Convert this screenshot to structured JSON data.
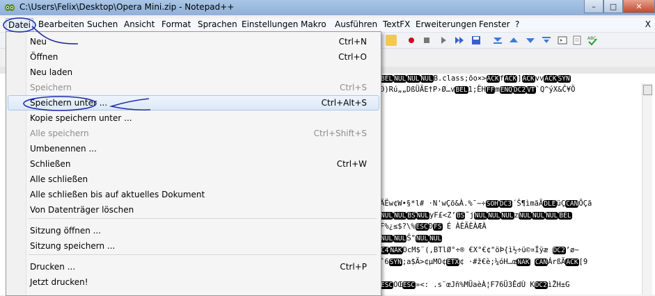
{
  "window": {
    "title": "C:\\Users\\Felix\\Desktop\\Opera Mini.zip - Notepad++",
    "minimize": "–",
    "maximize": "□",
    "close": "✕"
  },
  "menubar": {
    "items": [
      "Datei",
      "Bearbeiten",
      "Suchen",
      "Ansicht",
      "Format",
      "Sprachen",
      "Einstellungen",
      "Makro",
      "Ausführen",
      "TextFX",
      "Erweiterungen",
      "Fenster",
      "?"
    ],
    "close": "X"
  },
  "menu": {
    "items": [
      {
        "label": "Neu",
        "shortcut": "Ctrl+N",
        "enabled": true
      },
      {
        "label": "Öffnen",
        "shortcut": "Ctrl+O",
        "enabled": true
      },
      {
        "label": "Neu laden",
        "shortcut": "",
        "enabled": true
      },
      {
        "label": "Speichern",
        "shortcut": "Ctrl+S",
        "enabled": false
      },
      {
        "label": "Speichern unter ...",
        "shortcut": "Ctrl+Alt+S",
        "enabled": true,
        "highlighted": true
      },
      {
        "label": "Kopie speichern unter ...",
        "shortcut": "",
        "enabled": true
      },
      {
        "label": "Alle speichern",
        "shortcut": "Ctrl+Shift+S",
        "enabled": false
      },
      {
        "label": "Umbenennen ...",
        "shortcut": "",
        "enabled": true
      },
      {
        "label": "Schließen",
        "shortcut": "Ctrl+W",
        "enabled": true
      },
      {
        "label": "Alle schließen",
        "shortcut": "",
        "enabled": true
      },
      {
        "label": "Alle schließen bis auf aktuelles Dokument",
        "shortcut": "",
        "enabled": true
      },
      {
        "label": "Von Datenträger löschen",
        "shortcut": "",
        "enabled": true
      },
      {
        "label": "Sitzung öffnen ...",
        "shortcut": "",
        "enabled": true
      },
      {
        "label": "Sitzung speichern ...",
        "shortcut": "",
        "enabled": true
      },
      {
        "label": "Drucken ...",
        "shortcut": "Ctrl+P",
        "enabled": true
      },
      {
        "label": "Jetzt drucken!",
        "shortcut": "",
        "enabled": true
      }
    ]
  },
  "editor": {
    "lines": [
      {
        "parts": [
          {
            "c": "BEL"
          },
          {
            "c": "NUL"
          },
          {
            "c": "NUL"
          },
          {
            "c": "NUL"
          },
          {
            "t": "B.class;õo×>"
          },
          {
            "c": "ACK"
          },
          {
            "t": "f"
          },
          {
            "c": "ACK"
          },
          {
            "t": "]"
          },
          {
            "c": "ACK"
          },
          {
            "t": "vv"
          },
          {
            "c": "ACK"
          },
          {
            "c": "SYN"
          }
        ]
      },
      {
        "parts": [
          {
            "t": "Ð)Rú„„DßÜÄE†P›Ø…v"
          },
          {
            "c": "BEL"
          },
          {
            "t": "1;ËH"
          },
          {
            "c": "FF"
          },
          {
            "t": "m"
          },
          {
            "c": "ENQ"
          },
          {
            "c": "DC2"
          },
          {
            "c": "VT"
          },
          {
            "t": "`Q^ýX&Ĉ¥Ö"
          }
        ]
      },
      {
        "parts": [
          {
            "t": "ÄËw¢W•§*l# ·N'wÇõ&À.%¯~÷"
          },
          {
            "c": "SOH"
          },
          {
            "c": "DC3"
          },
          {
            "t": "´Š¶ìmãÄ"
          },
          {
            "c": "DLE"
          },
          {
            "t": "üÇ"
          },
          {
            "c": "CAN"
          },
          {
            "t": "ÖÇã"
          }
        ]
      },
      {
        "parts": [
          {
            "c": "NUL"
          },
          {
            "c": "NUL"
          },
          {
            "c": "BS"
          },
          {
            "c": "NUL"
          },
          {
            "t": "yF£<Z’"
          },
          {
            "c": "BS"
          },
          {
            "t": "˜j"
          },
          {
            "c": "NUL"
          },
          {
            "c": "NUL"
          },
          {
            "c": "NUL"
          },
          {
            "t": "z"
          },
          {
            "c": "NUL"
          },
          {
            "c": "NUL"
          },
          {
            "c": "NUL"
          },
          {
            "c": "BEL"
          }
        ]
      },
      {
        "parts": [
          {
            "t": "F%¿≤$?\\%"
          },
          {
            "c": "ESC"
          },
          {
            "t": "Ð"
          },
          {
            "c": "FS"
          },
          {
            "t": " É ÀÈÄÈÀÆÀ"
          }
        ]
      },
      {
        "parts": [
          {
            "c": "NUL"
          },
          {
            "c": "NUL"
          },
          {
            "t": "Š\""
          },
          {
            "c": "NUL"
          },
          {
            "c": "NUL"
          }
        ]
      },
      {
        "parts": [
          {
            "c": "C4"
          },
          {
            "c": "NAK"
          },
          {
            "t": "DcM$¨(,BTlØ°÷® €X°€¢\"öÞ{ì½÷ü©¤Íÿæ  "
          },
          {
            "c": "DC2"
          },
          {
            "t": "’ø~"
          }
        ]
      },
      {
        "parts": [
          {
            "t": "ˆ6"
          },
          {
            "c": "SYN"
          },
          {
            "t": ";a$Ä>¢µMO¢"
          },
          {
            "c": "ETX"
          },
          {
            "t": "¢ ·#ž€è;¼óH…œ"
          },
          {
            "c": "NAK"
          },
          {
            "t": " "
          },
          {
            "c": "CAN"
          },
          {
            "t": "ÁrßÄ"
          },
          {
            "c": "ACK"
          },
          {
            "t": "[9"
          }
        ]
      },
      {
        "parts": [
          {
            "c": "ESC"
          },
          {
            "t": "OŒ"
          },
          {
            "c": "ESC"
          },
          {
            "t": "»<:     .s¨œJñ%MÜaèÀ¦F76Ü3ÊdÙ K"
          },
          {
            "c": "DC2"
          },
          {
            "t": "ìŽH±G"
          }
        ]
      }
    ]
  }
}
